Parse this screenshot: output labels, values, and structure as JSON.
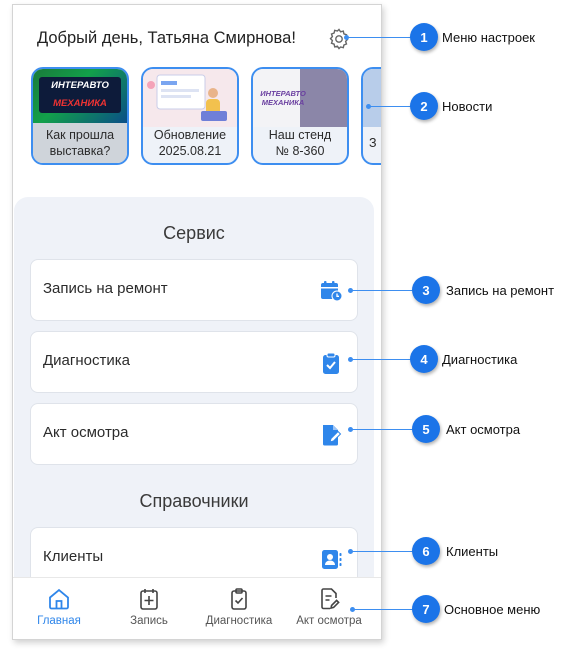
{
  "header": {
    "greeting": "Добрый день, Татьяна Смирнова!",
    "settings_icon": "gear-icon"
  },
  "stories": [
    {
      "line1": "Как прошла",
      "line2": "выставка?",
      "logo_text1": "ИНТЕРАВТО",
      "logo_text2": "МЕХАНИКА"
    },
    {
      "line1": "Обновление",
      "line2": "2025.08.21"
    },
    {
      "line1": "Наш стенд",
      "line2": "№ 8-360",
      "logo_text1": "ИНТЕРАВТО",
      "logo_text2": "МЕХАНИКА"
    },
    {
      "line1": "З",
      "line2": ""
    }
  ],
  "service": {
    "title": "Сервис",
    "items": [
      {
        "label": "Запись на ремонт",
        "icon": "calendar-clock-icon"
      },
      {
        "label": "Диагностика",
        "icon": "clipboard-check-icon"
      },
      {
        "label": "Акт осмотра",
        "icon": "document-edit-icon"
      }
    ]
  },
  "references": {
    "title": "Справочники",
    "items": [
      {
        "label": "Клиенты",
        "icon": "contact-card-icon"
      }
    ]
  },
  "bottom_nav": [
    {
      "label": "Главная",
      "icon": "home-icon",
      "active": true
    },
    {
      "label": "Запись",
      "icon": "calendar-plus-icon"
    },
    {
      "label": "Диагностика",
      "icon": "clipboard-check-icon"
    },
    {
      "label": "Акт осмотра",
      "icon": "document-edit-icon"
    }
  ],
  "callouts": [
    {
      "num": "1",
      "text": "Меню настроек"
    },
    {
      "num": "2",
      "text": "Новости"
    },
    {
      "num": "3",
      "text": "Запись на ремонт"
    },
    {
      "num": "4",
      "text": "Диагностика"
    },
    {
      "num": "5",
      "text": "Акт осмотра"
    },
    {
      "num": "6",
      "text": "Клиенты"
    },
    {
      "num": "7",
      "text": "Основное меню"
    }
  ],
  "colors": {
    "accent": "#2f86ea",
    "callout": "#1b74e8",
    "panel": "#eff2f8"
  }
}
